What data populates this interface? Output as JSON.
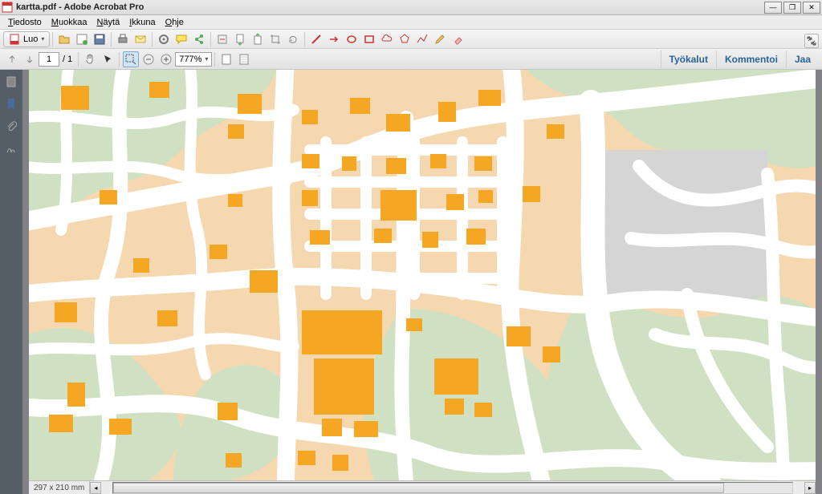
{
  "titlebar": {
    "filename": "kartta.pdf",
    "appname": "Adobe Acrobat Pro"
  },
  "menubar": {
    "items": [
      {
        "letter": "T",
        "rest": "iedosto"
      },
      {
        "letter": "M",
        "rest": "uokkaa"
      },
      {
        "letter": "N",
        "rest": "äytä"
      },
      {
        "letter": "I",
        "rest": "kkuna"
      },
      {
        "letter": "O",
        "rest": "hje"
      }
    ]
  },
  "toolbar": {
    "create_label": "Luo"
  },
  "pagenav": {
    "current": "1",
    "total": "/ 1",
    "zoom": "777%"
  },
  "rightpanel": {
    "tools": "Työkalut",
    "comment": "Kommentoi",
    "share": "Jaa"
  },
  "status": {
    "dimensions": "297 x 210 mm"
  },
  "icons": {
    "pdf": "📄",
    "minimize": "—",
    "maximize": "❐",
    "close": "✕",
    "expand": "⤢",
    "page": "▭",
    "bookmark": "🔖",
    "attach": "📎",
    "sign": "✎"
  },
  "map_colors": {
    "road": "#ffffff",
    "land": "#f5d7b0",
    "park": "#cfe0c3",
    "building": "#f5a623",
    "grey": "#d0d0d0"
  }
}
